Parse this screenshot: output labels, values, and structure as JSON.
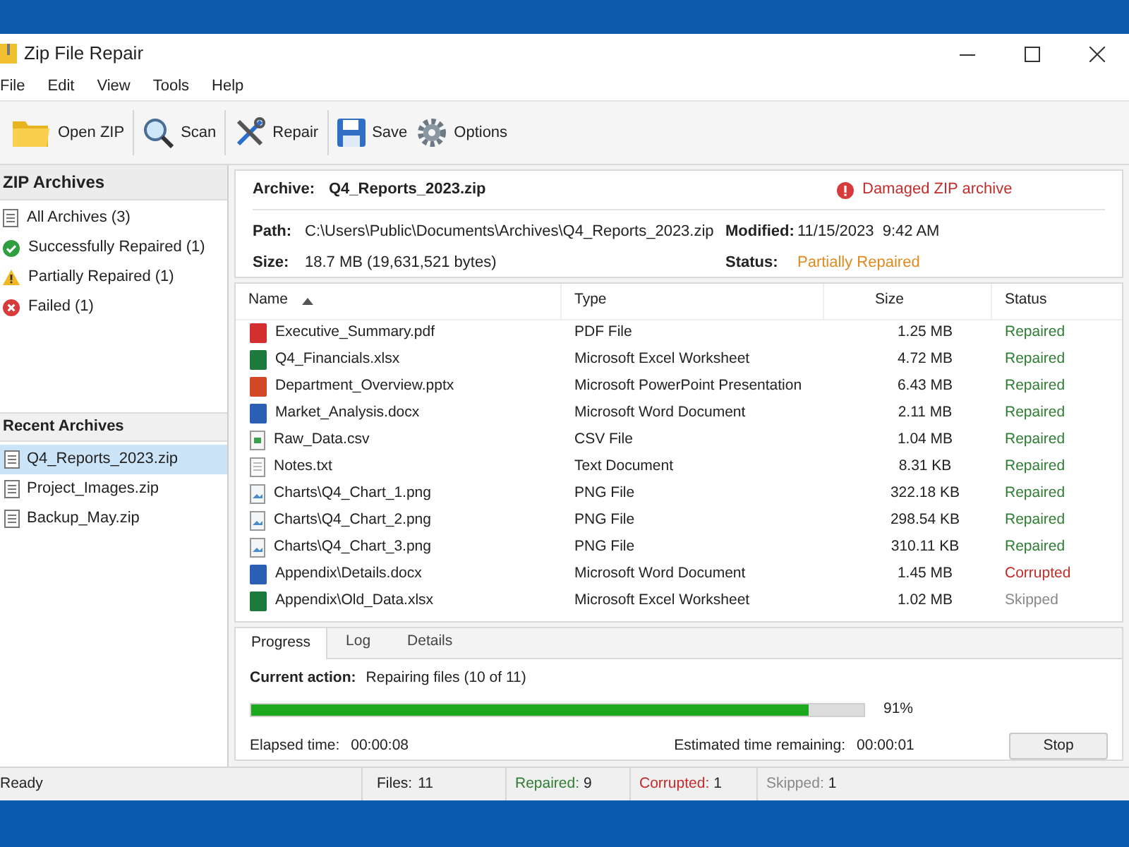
{
  "window": {
    "title": "Zip File Repair"
  },
  "menu": [
    "File",
    "Edit",
    "View",
    "Tools",
    "Help"
  ],
  "toolbar": [
    {
      "kind": "folder",
      "label": "Open ZIP"
    },
    {
      "kind": "scan",
      "label": "Scan"
    },
    {
      "kind": "repair",
      "label": "Repair"
    },
    {
      "kind": "save",
      "label": "Save"
    },
    {
      "kind": "options",
      "label": "Options"
    }
  ],
  "sidebar": {
    "title": "ZIP Archives",
    "filters": [
      {
        "kind": "all",
        "label": "All Archives (3)"
      },
      {
        "kind": "ok",
        "label": "Successfully Repaired (1)"
      },
      {
        "kind": "warn",
        "label": "Partially Repaired (1)"
      },
      {
        "kind": "fail",
        "label": "Failed (1)"
      }
    ],
    "recent_title": "Recent Archives",
    "recent": [
      {
        "label": "Q4_Reports_2023.zip",
        "selected": true
      },
      {
        "label": "Project_Images.zip",
        "selected": false
      },
      {
        "label": "Backup_May.zip",
        "selected": false
      }
    ]
  },
  "archive": {
    "label": "Archive:",
    "name": "Q4_Reports_2023.zip",
    "alert": "Damaged ZIP archive",
    "path_label": "Path:",
    "path": "C:\\Users\\Public\\Documents\\Archives\\Q4_Reports_2023.zip",
    "size_label": "Size:",
    "size": "18.7 MB (19,631,521 bytes)",
    "modified_label": "Modified:",
    "modified": "11/15/2023  9:42 AM",
    "status_label": "Status:",
    "status": "Partially Repaired"
  },
  "table": {
    "columns": [
      "Name",
      "Type",
      "Size",
      "Status"
    ],
    "rows": [
      {
        "kind": "pdf",
        "name": "Executive_Summary.pdf",
        "type": "PDF File",
        "size": "1.25 MB",
        "status": "Repaired",
        "color": "#2e7d32"
      },
      {
        "kind": "xlsx",
        "name": "Q4_Financials.xlsx",
        "type": "Microsoft Excel Worksheet",
        "size": "4.72 MB",
        "status": "Repaired",
        "color": "#2e7d32"
      },
      {
        "kind": "pptx",
        "name": "Department_Overview.pptx",
        "type": "Microsoft PowerPoint Presentation",
        "size": "6.43 MB",
        "status": "Repaired",
        "color": "#2e7d32"
      },
      {
        "kind": "docx",
        "name": "Market_Analysis.docx",
        "type": "Microsoft Word Document",
        "size": "2.11 MB",
        "status": "Repaired",
        "color": "#2e7d32"
      },
      {
        "kind": "csv",
        "name": "Raw_Data.csv",
        "type": "CSV File",
        "size": "1.04 MB",
        "status": "Repaired",
        "color": "#2e7d32"
      },
      {
        "kind": "txt",
        "name": "Notes.txt",
        "type": "Text Document",
        "size": "8.31 KB",
        "status": "Repaired",
        "color": "#2e7d32"
      },
      {
        "kind": "png",
        "name": "Charts\\Q4_Chart_1.png",
        "type": "PNG File",
        "size": "322.18 KB",
        "status": "Repaired",
        "color": "#2e7d32"
      },
      {
        "kind": "png",
        "name": "Charts\\Q4_Chart_2.png",
        "type": "PNG File",
        "size": "298.54 KB",
        "status": "Repaired",
        "color": "#2e7d32"
      },
      {
        "kind": "png",
        "name": "Charts\\Q4_Chart_3.png",
        "type": "PNG File",
        "size": "310.11 KB",
        "status": "Repaired",
        "color": "#2e7d32"
      },
      {
        "kind": "docx",
        "name": "Appendix\\Details.docx",
        "type": "Microsoft Word Document",
        "size": "1.45 MB",
        "status": "Corrupted",
        "color": "#c42b2b"
      },
      {
        "kind": "xlsx",
        "name": "Appendix\\Old_Data.xlsx",
        "type": "Microsoft Excel Worksheet",
        "size": "1.02 MB",
        "status": "Skipped",
        "color": "#888888"
      }
    ]
  },
  "tabs": [
    {
      "label": "Progress",
      "selected": true
    },
    {
      "label": "Log",
      "selected": false
    },
    {
      "label": "Details",
      "selected": false
    }
  ],
  "progress": {
    "action_label": "Current action:",
    "action": "Repairing files (10 of 11)",
    "level": 0.91,
    "percent": "91%",
    "elapsed_label": "Elapsed time:",
    "elapsed": "00:00:08",
    "remaining_label": "Estimated time remaining:",
    "remaining": "00:00:01",
    "stop": "Stop"
  },
  "status_bar": {
    "text": "Ready",
    "files_label": "Files:",
    "files": "11",
    "repaired_label": "Repaired:",
    "repaired": "9",
    "corrupted_label": "Corrupted:",
    "corrupted": "1",
    "skipped_label": "Skipped:",
    "skipped": "1"
  }
}
